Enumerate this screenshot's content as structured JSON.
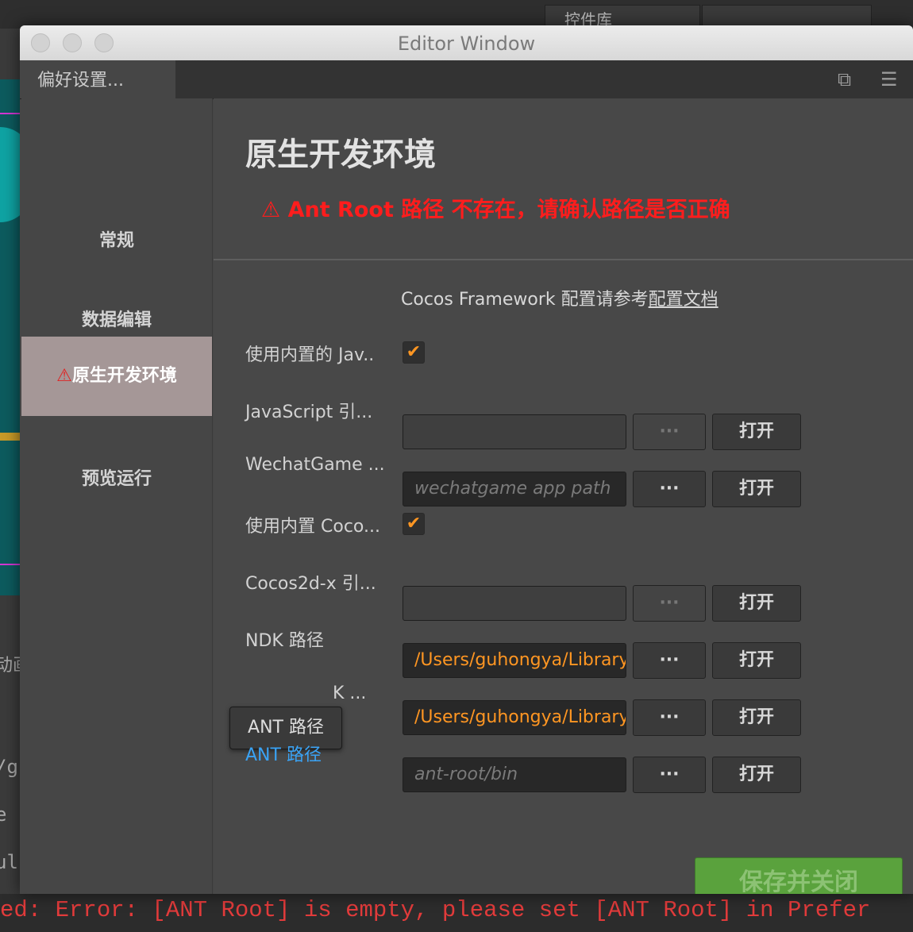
{
  "background": {
    "top_tab": "控件库",
    "strip_labels": [
      "动画",
      "/g",
      "e",
      "ul"
    ],
    "console_error": "ed: Error: [ANT Root] is empty, please set [ANT Root] in Prefer"
  },
  "window": {
    "title": "Editor Window",
    "panel_tab": "偏好设置..."
  },
  "sidebar": {
    "items": [
      {
        "label": "常规"
      },
      {
        "label": "数据编辑"
      },
      {
        "label": "原生开发环境",
        "warning_icon": "⚠"
      },
      {
        "label": "预览运行"
      }
    ]
  },
  "content": {
    "title": "原生开发环境",
    "warning_icon": "⚠",
    "warning_text": "Ant Root 路径 不存在，请确认路径是否正确",
    "cocos_note": "Cocos Framework 配置请参考",
    "cocos_link": "配置文档",
    "rows": [
      {
        "label": "使用内置的 Jav.."
      },
      {
        "label": "JavaScript 引...",
        "value": "",
        "dots": "···",
        "open": "打开"
      },
      {
        "label": "WechatGame ...",
        "placeholder": "wechatgame app path",
        "dots": "···",
        "open": "打开"
      },
      {
        "label": "使用内置 Coco..."
      },
      {
        "label": "Cocos2d-x 引...",
        "value": "",
        "dots": "···",
        "open": "打开"
      },
      {
        "label": "NDK 路径",
        "value": "/Users/guhongya/Library",
        "dots": "···",
        "open": "打开"
      },
      {
        "label": "K ...",
        "value": "/Users/guhongya/Library",
        "dots": "···",
        "open": "打开"
      },
      {
        "label": "ANT 路径",
        "placeholder": "ant-root/bin",
        "dots": "···",
        "open": "打开"
      }
    ],
    "checkmark": "✔",
    "tooltip": "ANT 路径",
    "save_button": "保存并关闭"
  },
  "colors": {
    "accent_orange": "#ff9622",
    "error_red": "#ff1d1d",
    "link_blue": "#3aa3f5",
    "save_green": "#5aa23d"
  }
}
